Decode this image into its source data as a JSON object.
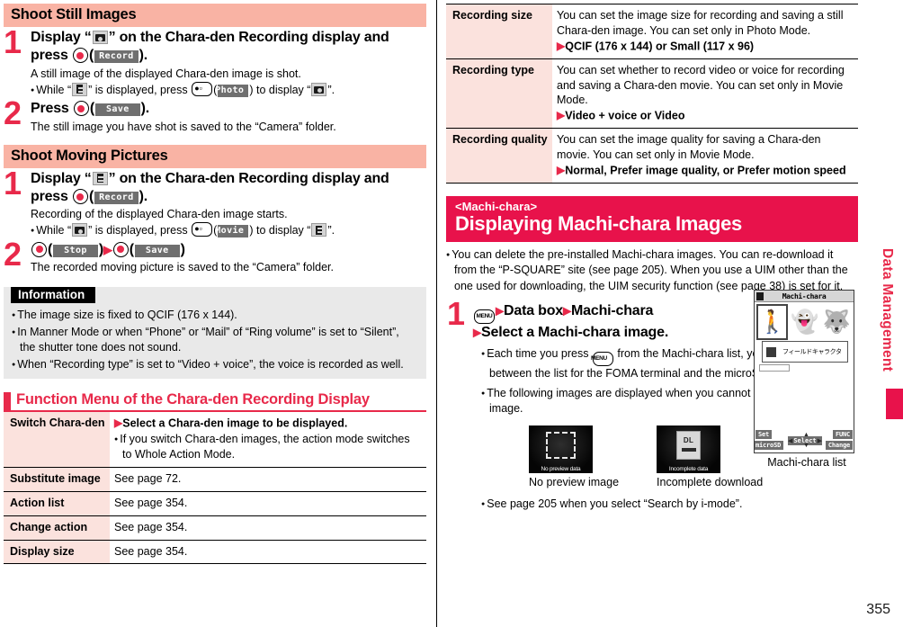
{
  "page": {
    "number": "355",
    "side_tab": "Data Management"
  },
  "left": {
    "section1": {
      "header": "Shoot Still Images",
      "steps": [
        {
          "num": "1",
          "title_pre": "Display “",
          "title_icon": "still-image-icon",
          "title_mid": "” on the Chara-den Recording display and press ",
          "key": "center-key",
          "softkey": "Record",
          "title_end": ").",
          "body": "A still image of the displayed Chara-den image is shot.",
          "bullet_pre": "While “",
          "bullet_icon": "movie-icon",
          "bullet_mid": "” is displayed, press ",
          "bullet_key": "camera-key",
          "bullet_soft": "Photo",
          "bullet_mid2": ") to display “",
          "bullet_icon2": "still-image-icon",
          "bullet_end": "”."
        },
        {
          "num": "2",
          "title_pre": "Press ",
          "key": "center-key",
          "softkey": "Save",
          "title_end": ").",
          "body": "The still image you have shot is saved to the “Camera” folder."
        }
      ]
    },
    "section2": {
      "header": "Shoot Moving Pictures",
      "steps": [
        {
          "num": "1",
          "title_pre": "Display “",
          "title_icon": "movie-icon",
          "title_mid": "” on the Chara-den Recording display and press ",
          "key": "center-key",
          "softkey": "Record",
          "title_end": ").",
          "body": "Recording of the displayed Chara-den image starts.",
          "bullet_pre": "While “",
          "bullet_icon": "still-image-icon",
          "bullet_mid": "” is displayed, press ",
          "bullet_key": "camera-key",
          "bullet_soft": "Movie",
          "bullet_mid2": ") to display “",
          "bullet_icon2": "movie-icon",
          "bullet_end": "”."
        },
        {
          "num": "2",
          "softkey1": "Stop",
          "softkey2": "Save",
          "body": "The recorded moving picture is saved to the “Camera” folder."
        }
      ]
    },
    "information": {
      "title": "Information",
      "items": [
        "The image size is fixed to QCIF (176 x 144).",
        "In Manner Mode or when “Phone” or “Mail” of “Ring volume” is set to “Silent”, the shutter tone does not sound.",
        "When “Recording type” is set to “Video + voice”, the voice is recorded as well."
      ]
    },
    "function_menu": {
      "heading": "Function Menu of the Chara-den Recording Display",
      "rows": [
        {
          "name": "Switch Chara-den",
          "arrow_line": "Select a Chara-den image to be displayed.",
          "sub": "If you switch Chara-den images, the action mode switches to Whole Action Mode."
        },
        {
          "name": "Substitute image",
          "desc": "See page 72."
        },
        {
          "name": "Action list",
          "desc": "See page 354."
        },
        {
          "name": "Change action",
          "desc": "See page 354."
        },
        {
          "name": "Display size",
          "desc": "See page 354."
        }
      ]
    }
  },
  "right": {
    "spec_table": [
      {
        "name": "Recording size",
        "desc": "You can set the image size for recording and saving a still Chara-den image. You can set only in Photo Mode.",
        "options": "QCIF (176 x 144) or Small (117 x 96)"
      },
      {
        "name": "Recording type",
        "desc": "You can set whether to record video or voice for recording and saving a Chara-den movie. You can set only in Movie Mode.",
        "options": "Video + voice or Video"
      },
      {
        "name": "Recording quality",
        "desc": "You can set the image quality for saving a Chara-den movie. You can set only in Movie Mode.",
        "options": "Normal, Prefer image quality, or Prefer motion speed"
      }
    ],
    "banner": {
      "tag": "<Machi-chara>",
      "title": "Displaying Machi-chara Images"
    },
    "intro": "You can delete the pre-installed Machi-chara images. You can re-download it from the “P-SQUARE” site (see page 205). When you use a UIM other than the one used for downloading, the UIM security function (see page 38) is set for it.",
    "step": {
      "num": "1",
      "menu_key": "MENU",
      "line1_a": "Data box",
      "line1_b": "Machi-chara",
      "line2": "Select a Machi-chara image."
    },
    "bullets": [
      {
        "pre": "Each time you press ",
        "key": "MENU",
        "post": " from the Machi-chara list, you can switch between the list for the FOMA terminal and the microSD card."
      },
      {
        "text": "The following images are displayed when you cannot display a preview image."
      }
    ],
    "thumbs": [
      {
        "caption_inner": "No preview data",
        "label": "No preview image",
        "kind": "dashed-box"
      },
      {
        "caption_inner": "Incomplete  data",
        "label": "Incomplete download",
        "kind": "dl-box",
        "dl_text": "DL"
      }
    ],
    "last_bullet": "See page 205 when you select “Search by i-mode”.",
    "phone": {
      "title": "Machi-chara",
      "tooltip": "フィールドキャラクター",
      "softkeys": {
        "left_top": "Set",
        "left_bottom": "microSD",
        "right_top": "FUNC",
        "right_bottom": "Change",
        "center": "Select"
      },
      "caption": "Machi-chara list"
    }
  }
}
